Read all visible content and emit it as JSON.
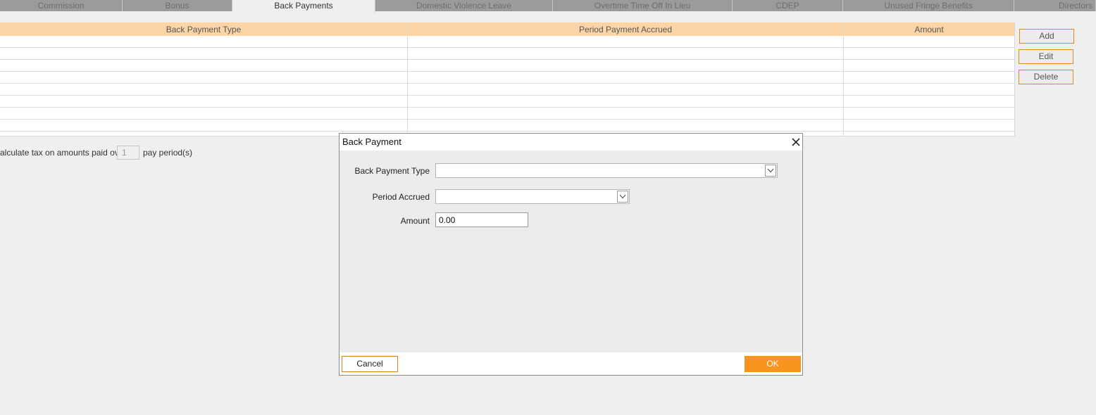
{
  "tabs": [
    {
      "label": "Commission"
    },
    {
      "label": "Bonus"
    },
    {
      "label": "Back Payments"
    },
    {
      "label": "Domestic Violence Leave"
    },
    {
      "label": "Overtime Time Off In Lieu"
    },
    {
      "label": "CDEP"
    },
    {
      "label": "Unused Fringe Benefits"
    },
    {
      "label": "Directors F"
    }
  ],
  "grid": {
    "columns": [
      "Back Payment Type",
      "Period Payment Accrued",
      "Amount"
    ],
    "rows": [
      [
        "",
        "",
        ""
      ],
      [
        "",
        "",
        ""
      ],
      [
        "",
        "",
        ""
      ],
      [
        "",
        "",
        ""
      ],
      [
        "",
        "",
        ""
      ],
      [
        "",
        "",
        ""
      ],
      [
        "",
        "",
        ""
      ],
      [
        "",
        "",
        ""
      ]
    ]
  },
  "actions": {
    "add": "Add",
    "edit": "Edit",
    "delete": "Delete"
  },
  "calc": {
    "prefix": "alculate tax on amounts paid over",
    "periods": "1",
    "suffix": "pay period(s)"
  },
  "dialog": {
    "title": "Back Payment",
    "back_payment_type_label": "Back Payment Type",
    "back_payment_type_value": "",
    "period_accrued_label": "Period Accrued",
    "period_accrued_value": "",
    "amount_label": "Amount",
    "amount_value": "0.00",
    "cancel": "Cancel",
    "ok": "OK"
  },
  "colors": {
    "accent": "#f7941d",
    "header": "#fcd5a7",
    "tab": "#9b9b9b"
  },
  "icons": {
    "close": "close-icon",
    "dropdown": "chevron-down-icon"
  }
}
